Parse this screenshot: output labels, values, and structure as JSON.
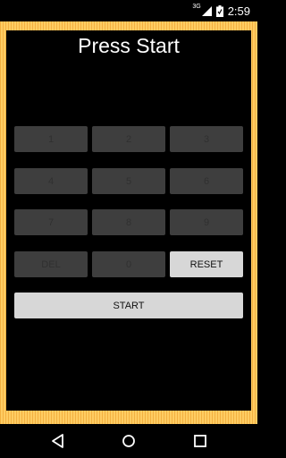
{
  "status": {
    "network": "3G",
    "time": "2:59"
  },
  "screen": {
    "title": "Press Start"
  },
  "keypad": {
    "k1": "1",
    "k2": "2",
    "k3": "3",
    "k4": "4",
    "k5": "5",
    "k6": "6",
    "k7": "7",
    "k8": "8",
    "k9": "9",
    "del": "DEL",
    "k0": "0",
    "reset": "RESET",
    "start": "START"
  },
  "colors": {
    "frame": "#ffcd63",
    "button_enabled": "#d7d7d7",
    "button_disabled": "#3e3e3e"
  }
}
